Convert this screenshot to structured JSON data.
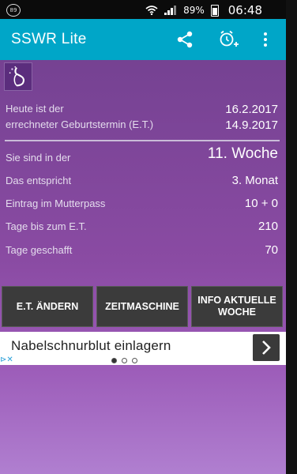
{
  "status_bar": {
    "notification_badge": "89",
    "battery": "89%",
    "time": "06:48"
  },
  "app_bar": {
    "title": "SSWR Lite"
  },
  "info": {
    "rows": [
      {
        "label": "Heute ist der",
        "value": "16.2.2017"
      },
      {
        "label": "errechneter Geburtstermin (E.T.)",
        "value": "14.9.2017"
      },
      {
        "label": "Sie sind in der",
        "value": "11. Woche"
      },
      {
        "label": "Das entspricht",
        "value": "3. Monat"
      },
      {
        "label": "Eintrag im Mutterpass",
        "value": "10 + 0"
      },
      {
        "label": "Tage bis zum E.T.",
        "value": "210"
      },
      {
        "label": "Tage geschafft",
        "value": "70"
      }
    ]
  },
  "buttons": {
    "change_et": "E.T. ÄNDERN",
    "time_machine": "ZEITMASCHINE",
    "info_week_line1": "INFO AKTUELLE",
    "info_week_line2": "WOCHE"
  },
  "ad": {
    "text": "Nabelschnurblut einlagern",
    "choices": "⊳✕"
  },
  "colors": {
    "appbar": "#00a6c8",
    "background_top": "#6f3f8d",
    "background_bottom": "#b07fd0",
    "button": "#3b3b3b"
  }
}
